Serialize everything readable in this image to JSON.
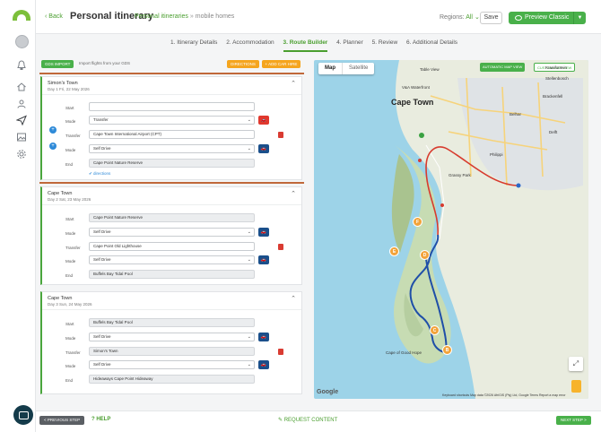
{
  "header": {
    "back_label": "Back",
    "title": "Personal itinerary",
    "breadcrumb": [
      "Personal itineraries",
      "»",
      "mobile homes"
    ],
    "regions_label": "Regions:",
    "regions_value": "All",
    "save_label": "Save",
    "preview_label": "Preview Classic"
  },
  "steps": [
    "1. Itinerary Details",
    "2. Accommodation",
    "3. Route Builder",
    "4. Planner",
    "5. Review",
    "6. Additional Details"
  ],
  "active_step": "3. Route Builder",
  "toolbar": {
    "gds_label": "GDS IMPORT",
    "gds_hint": "Import flights from your GDS",
    "directions_label": "DIRECTIONS",
    "add_car_hire_label": "+ ADD CAR HIRE"
  },
  "days": [
    {
      "title": "Simon's Town",
      "date": "Day 1 Fri, 22 May 2026",
      "start": "",
      "mode1": "Transfer",
      "transfer": "Cape Town International Airport (CPT)",
      "mode2": "Self Drive",
      "end": "Cape Point Nature Reserve",
      "directions_link": "directions"
    },
    {
      "title": "Cape Town",
      "date": "Day 2 Sat, 23 May 2026",
      "start": "Cape Point Nature Reserve",
      "mode1": "Self Drive",
      "transfer": "Cape Point Old Lighthouse",
      "mode2": "Self Drive",
      "end": "Buffels Bay Tidal Pool"
    },
    {
      "title": "Cape Town",
      "date": "Day 3 Sun, 24 May 2026",
      "start": "Buffels Bay Tidal Pool",
      "mode1": "Self Drive",
      "transfer": "Simon's Town",
      "mode2": "Self Drive",
      "end": "Hideaways Cape Point Hideaway"
    }
  ],
  "labels": {
    "start": "Start",
    "mode": "Mode",
    "transfer": "Transfer",
    "end": "End"
  },
  "map": {
    "tab_map": "Map",
    "tab_satellite": "Satellite",
    "auto_view_label": "AUTOMATIC MAP VIEW",
    "custom_view_label": "CUSTOM MAP VIEW",
    "city_label": "Cape Town",
    "towns": [
      "Stellenbosch",
      "Delft",
      "Belhar",
      "Philippi",
      "Grassy Park",
      "Kraaifontein",
      "Brackenfell",
      "Table View",
      "V&A Waterfront",
      "Cape of Good Hope"
    ],
    "markers": [
      "F",
      "E",
      "D",
      "C",
      "B"
    ],
    "google_label": "Google",
    "footer_text": "Keyboard shortcuts   Map data ©2026 AfriGIS (Pty) Ltd, Google   Terms   Report a map error",
    "route_color": "#1f4fa8",
    "marker_color": "#f2a33a"
  },
  "footer": {
    "prev_label": "< PREVIOUS STEP",
    "help_label": "HELP",
    "request_label": "REQUEST CONTENT",
    "next_label": "NEXT STEP >"
  },
  "colors": {
    "brand_green": "#49b04a",
    "accent_orange": "#f5a51e",
    "selection_outline": "#c0683a"
  }
}
